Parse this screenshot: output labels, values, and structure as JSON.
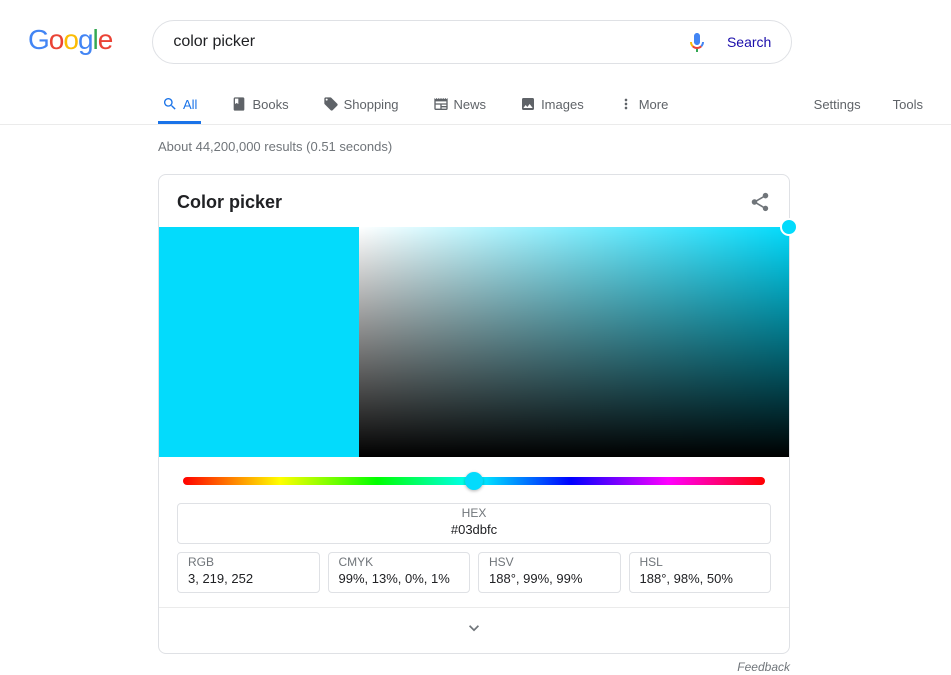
{
  "search": {
    "query": "color picker",
    "button_label": "Search"
  },
  "tabs": {
    "all": "All",
    "books": "Books",
    "shopping": "Shopping",
    "news": "News",
    "images": "Images",
    "more": "More",
    "settings": "Settings",
    "tools": "Tools"
  },
  "results_info": "About 44,200,000 results (0.51 seconds)",
  "card": {
    "title": "Color picker",
    "selected_color": "#03dbfc",
    "hue_position_pct": 50,
    "formats": {
      "hex": {
        "label": "HEX",
        "value": "#03dbfc"
      },
      "rgb": {
        "label": "RGB",
        "value": "3, 219, 252"
      },
      "cmyk": {
        "label": "CMYK",
        "value": "99%, 13%, 0%, 1%"
      },
      "hsv": {
        "label": "HSV",
        "value": "188°, 99%, 99%"
      },
      "hsl": {
        "label": "HSL",
        "value": "188°, 98%, 50%"
      }
    }
  },
  "feedback": "Feedback"
}
